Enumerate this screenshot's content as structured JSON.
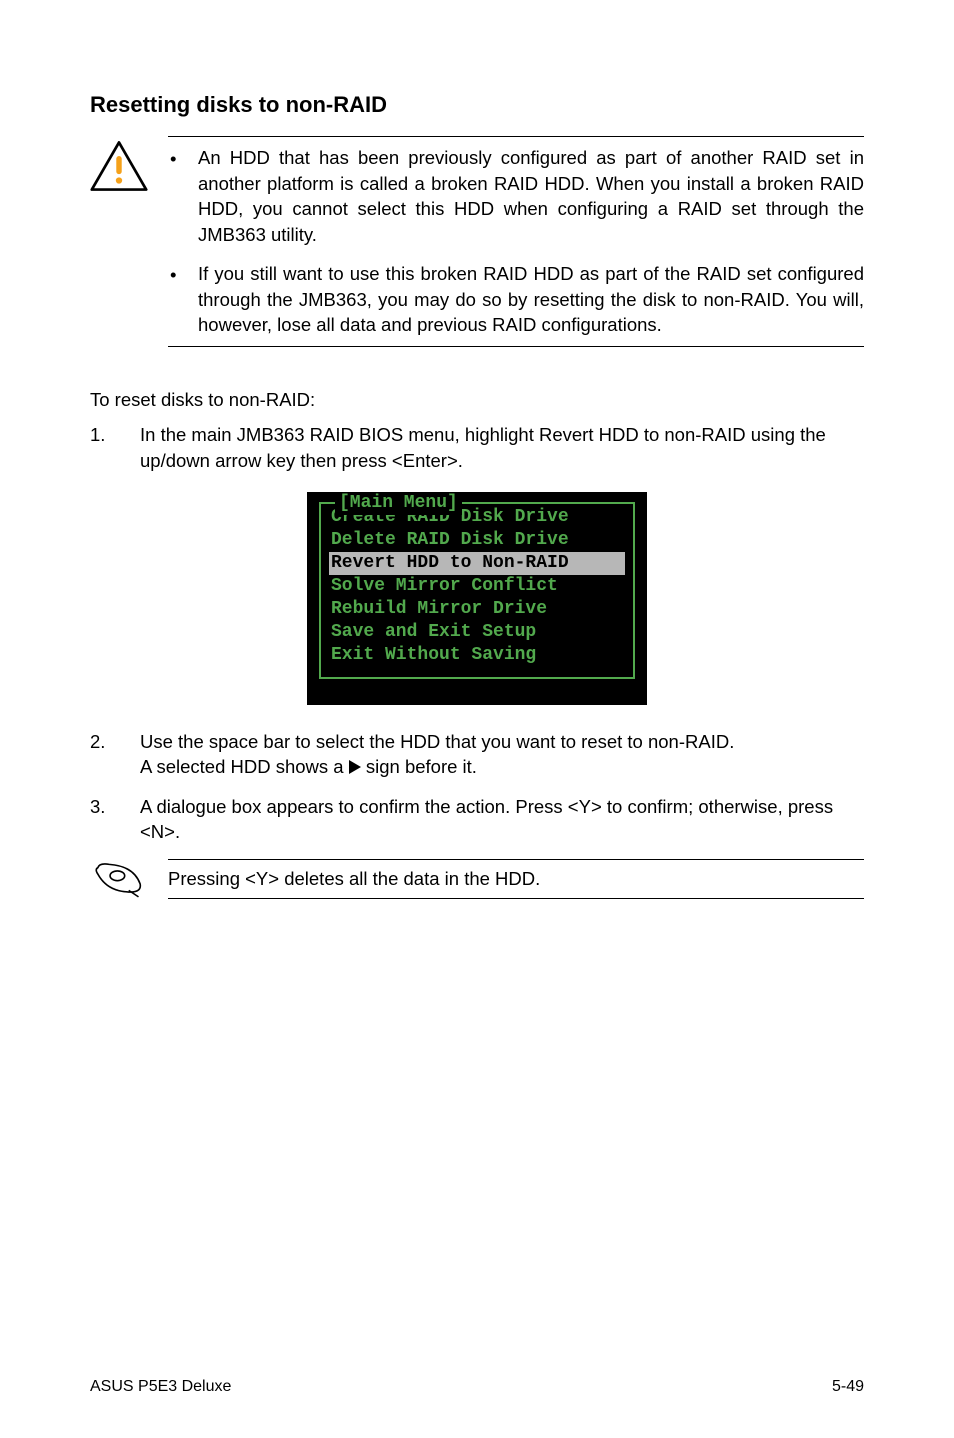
{
  "heading": "Resetting disks to non-RAID",
  "warning": {
    "items": [
      "An HDD that has been previously configured as part of another RAID set in another platform is called a broken RAID HDD. When you install a broken RAID HDD, you cannot select this HDD when configuring a RAID set through the JMB363 utility.",
      "If you still want to use this broken RAID HDD as part of the RAID set configured through the JMB363, you may do so by resetting the disk to non-RAID. You will, however, lose all data and previous RAID configurations."
    ]
  },
  "intro": "To reset disks to non-RAID:",
  "steps": [
    {
      "num": "1.",
      "text": "In the main JMB363 RAID BIOS menu, highlight Revert HDD to non-RAID using the up/down arrow key then press <Enter>."
    },
    {
      "num": "2.",
      "text_a": "Use the space bar to select the HDD that you want to reset to non-RAID.",
      "text_b_pre": "A selected HDD shows a ",
      "text_b_post": " sign before it."
    },
    {
      "num": "3.",
      "text": "A dialogue box appears to confirm the action. Press <Y> to confirm; otherwise, press <N>."
    }
  ],
  "bios": {
    "title": "[Main Menu]",
    "items": [
      "Create RAID Disk Drive",
      "Delete RAID Disk Drive",
      "Revert HDD to Non-RAID",
      "Solve Mirror Conflict",
      "Rebuild Mirror Drive",
      "Save and Exit Setup",
      "Exit Without Saving"
    ],
    "selected_index": 2
  },
  "note": "Pressing <Y> deletes all the data in the HDD.",
  "footer": {
    "left": "ASUS P5E3 Deluxe",
    "right": "5-49"
  }
}
